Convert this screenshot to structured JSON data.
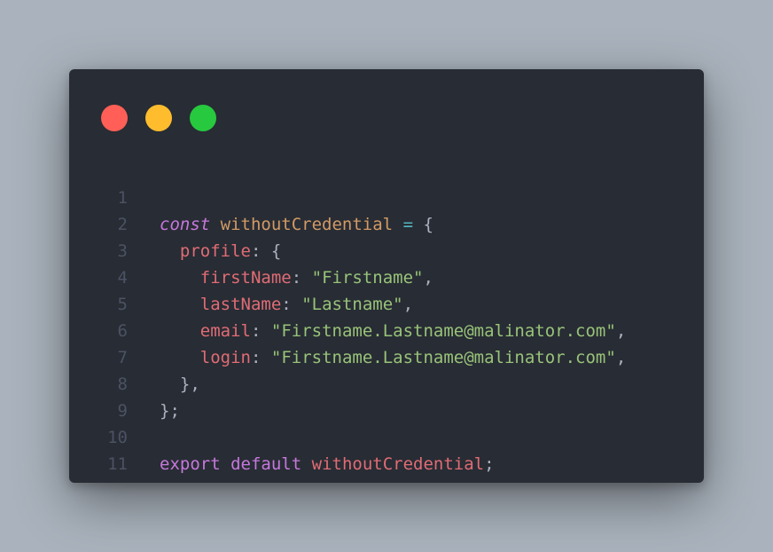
{
  "window": {
    "controls": [
      "close",
      "minimize",
      "maximize"
    ],
    "colors": {
      "background": "#282c34",
      "close": "#ff5f56",
      "minimize": "#ffbd2e",
      "maximize": "#27c93f"
    }
  },
  "code": {
    "line_numbers": [
      "1",
      "2",
      "3",
      "4",
      "5",
      "6",
      "7",
      "8",
      "9",
      "10",
      "11"
    ],
    "tokens": {
      "const": "const",
      "var_name": "withoutCredential",
      "eq": "=",
      "open_brace": "{",
      "profile": "profile",
      "colon": ":",
      "firstName": "firstName",
      "firstName_val": "\"Firstname\"",
      "lastName": "lastName",
      "lastName_val": "\"Lastname\"",
      "email": "email",
      "email_val": "\"Firstname.Lastname@malinator.com\"",
      "login": "login",
      "login_val": "\"Firstname.Lastname@malinator.com\"",
      "comma": ",",
      "close_brace_comma": "},",
      "close_brace_semi": "};",
      "export": "export",
      "default": "default",
      "export_name": "withoutCredential",
      "semi": ";"
    }
  }
}
